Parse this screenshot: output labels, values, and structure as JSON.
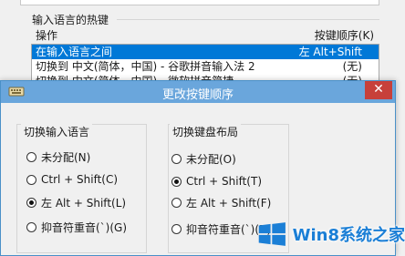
{
  "background": {
    "group_label": "输入语言的热键",
    "header": {
      "operation": "操作",
      "key_order": "按键顺序(K)"
    },
    "rows": [
      {
        "op": "在输入语言之间",
        "key": "左 Alt+Shift",
        "selected": true
      },
      {
        "op": "切换到 中文(简体，中国) - 谷歌拼音输入法 2",
        "key": "(无)",
        "selected": false
      },
      {
        "op": "切换到 中文(简体，中国) - 微软拼音简捷",
        "key": "(无)",
        "selected": false
      }
    ]
  },
  "dialog": {
    "title": "更改按键顺序",
    "close_label": "✕",
    "left_group": {
      "legend": "切换输入语言",
      "options": [
        {
          "label": "未分配(N)",
          "checked": false
        },
        {
          "label": "Ctrl + Shift(C)",
          "checked": false
        },
        {
          "label": "左 Alt + Shift(L)",
          "checked": true
        },
        {
          "label": "抑音符重音(`)(G)",
          "checked": false
        }
      ]
    },
    "right_group": {
      "legend": "切换键盘布局",
      "options": [
        {
          "label": "未分配(O)",
          "checked": false
        },
        {
          "label": "Ctrl + Shift(T)",
          "checked": true
        },
        {
          "label": "左 Alt + Shift(F)",
          "checked": false
        },
        {
          "label": "抑音符重音(`)(R)",
          "checked": false
        }
      ]
    }
  },
  "watermark": {
    "text": "Win8系统之家",
    "logo_icon": "windows-logo-icon",
    "color": "#1b7fd6"
  }
}
